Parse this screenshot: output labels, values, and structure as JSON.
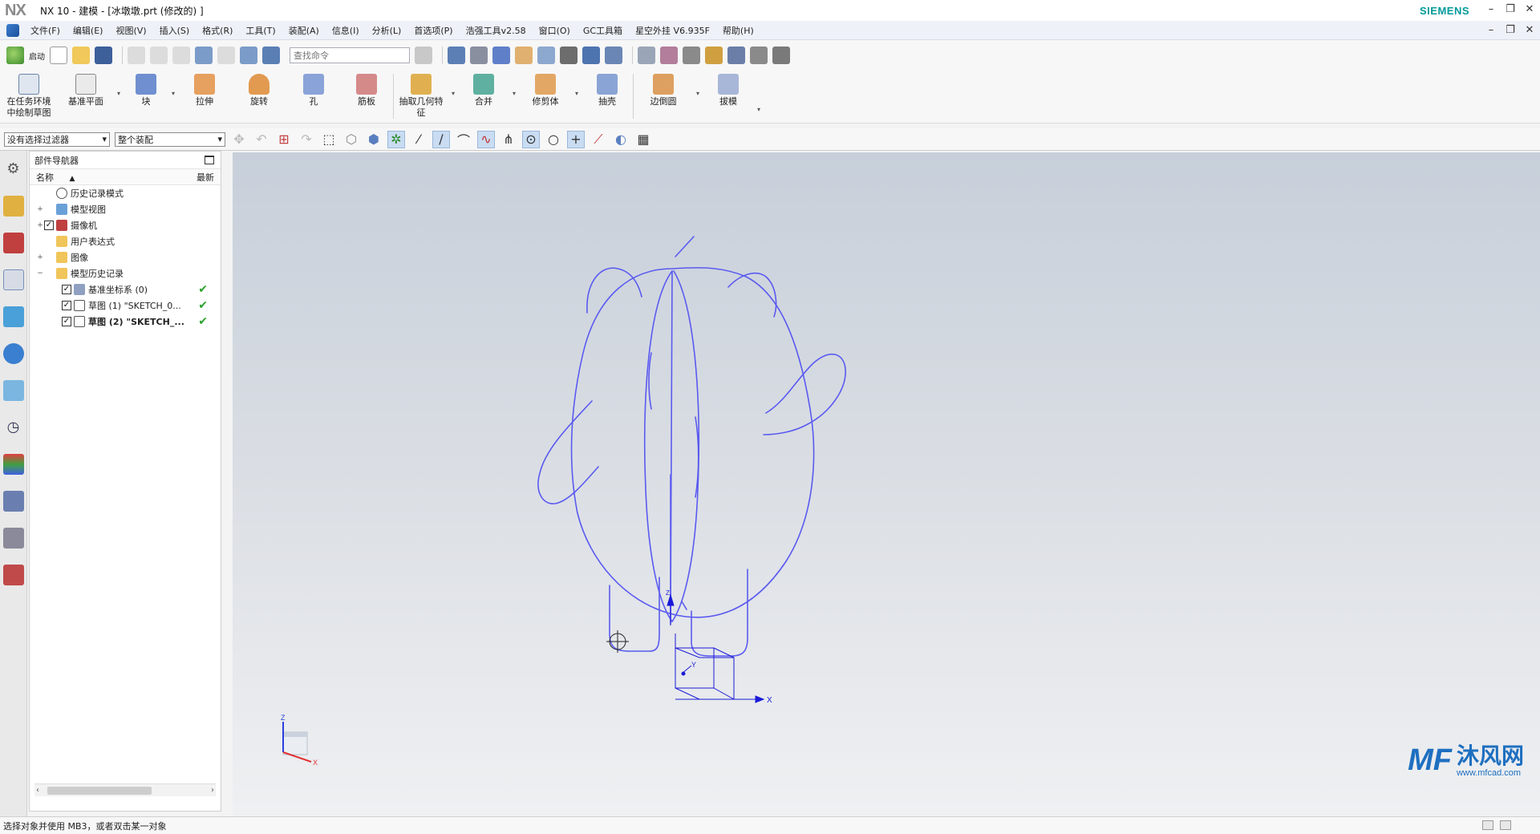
{
  "titlebar": {
    "logo": "NX",
    "title": "NX 10 - 建模 - [冰墩墩.prt  (修改的)  ]",
    "brand": "SIEMENS",
    "minimize": "–",
    "restore": "❐",
    "close": "✕"
  },
  "menubar": {
    "items": [
      "文件(F)",
      "编辑(E)",
      "视图(V)",
      "插入(S)",
      "格式(R)",
      "工具(T)",
      "装配(A)",
      "信息(I)",
      "分析(L)",
      "首选项(P)",
      "浩强工具v2.58",
      "窗口(O)",
      "GC工具箱",
      "星空外挂 V6.935F",
      "帮助(H)"
    ],
    "mdi_minimize": "–",
    "mdi_restore": "❐",
    "mdi_close": "✕"
  },
  "quickbar": {
    "start_label": "启动",
    "search_placeholder": "查找命令"
  },
  "ribbon": {
    "buttons": [
      {
        "label": "在任务环境\n中绘制草图",
        "icon": "sketch-in-task-icon"
      },
      {
        "label": "基准平面",
        "icon": "datum-plane-icon"
      },
      {
        "label": "块",
        "icon": "block-icon"
      },
      {
        "label": "拉伸",
        "icon": "extrude-icon"
      },
      {
        "label": "旋转",
        "icon": "revolve-icon"
      },
      {
        "label": "孔",
        "icon": "hole-icon"
      },
      {
        "label": "筋板",
        "icon": "rib-icon"
      },
      {
        "label": "抽取几何特\n征",
        "icon": "extract-geometry-icon"
      },
      {
        "label": "合并",
        "icon": "unite-icon"
      },
      {
        "label": "修剪体",
        "icon": "trim-body-icon"
      },
      {
        "label": "抽壳",
        "icon": "shell-icon"
      },
      {
        "label": "边倒圆",
        "icon": "edge-blend-icon"
      },
      {
        "label": "拔模",
        "icon": "draft-icon"
      }
    ]
  },
  "selbar": {
    "filter_value": "没有选择过滤器",
    "scope_value": "整个装配"
  },
  "navigator": {
    "title": "部件导航器",
    "col_name": "名称",
    "col_latest": "最新",
    "tree": [
      {
        "label": "历史记录模式",
        "indent": 0,
        "exp": "",
        "icon": "clock-icon",
        "check": false,
        "ok": false
      },
      {
        "label": "模型视图",
        "indent": 0,
        "exp": "+",
        "icon": "model-views-icon",
        "check": false,
        "ok": false
      },
      {
        "label": "摄像机",
        "indent": 0,
        "exp": "+",
        "icon": "camera-icon",
        "check": true,
        "ok": false
      },
      {
        "label": "用户表达式",
        "indent": 0,
        "exp": "",
        "icon": "folder-icon",
        "check": false,
        "ok": false
      },
      {
        "label": "图像",
        "indent": 0,
        "exp": "+",
        "icon": "folder-icon",
        "check": false,
        "ok": false
      },
      {
        "label": "模型历史记录",
        "indent": 0,
        "exp": "−",
        "icon": "folder-icon",
        "check": false,
        "ok": false
      },
      {
        "label": "基准坐标系 (0)",
        "indent": 1,
        "exp": "",
        "icon": "datum-csys-icon",
        "check": true,
        "ok": true
      },
      {
        "label": "草图 (1) \"SKETCH_0...",
        "indent": 1,
        "exp": "",
        "icon": "sketch-icon",
        "check": true,
        "ok": true
      },
      {
        "label": "草图 (2) \"SKETCH_...",
        "indent": 1,
        "exp": "",
        "icon": "sketch-icon",
        "check": true,
        "ok": true,
        "bold": true
      }
    ]
  },
  "viewport": {
    "csys_labels": {
      "x": "X",
      "y": "Y",
      "z": "Z"
    },
    "triad_labels": {
      "x": "X",
      "z": "Z"
    },
    "sketch_color": "#5a5af0",
    "watermark_cn": "沐风网",
    "watermark_url": "www.mfcad.com"
  },
  "statusbar": {
    "message": "选择对象并使用 MB3，或者双击某一对象"
  }
}
